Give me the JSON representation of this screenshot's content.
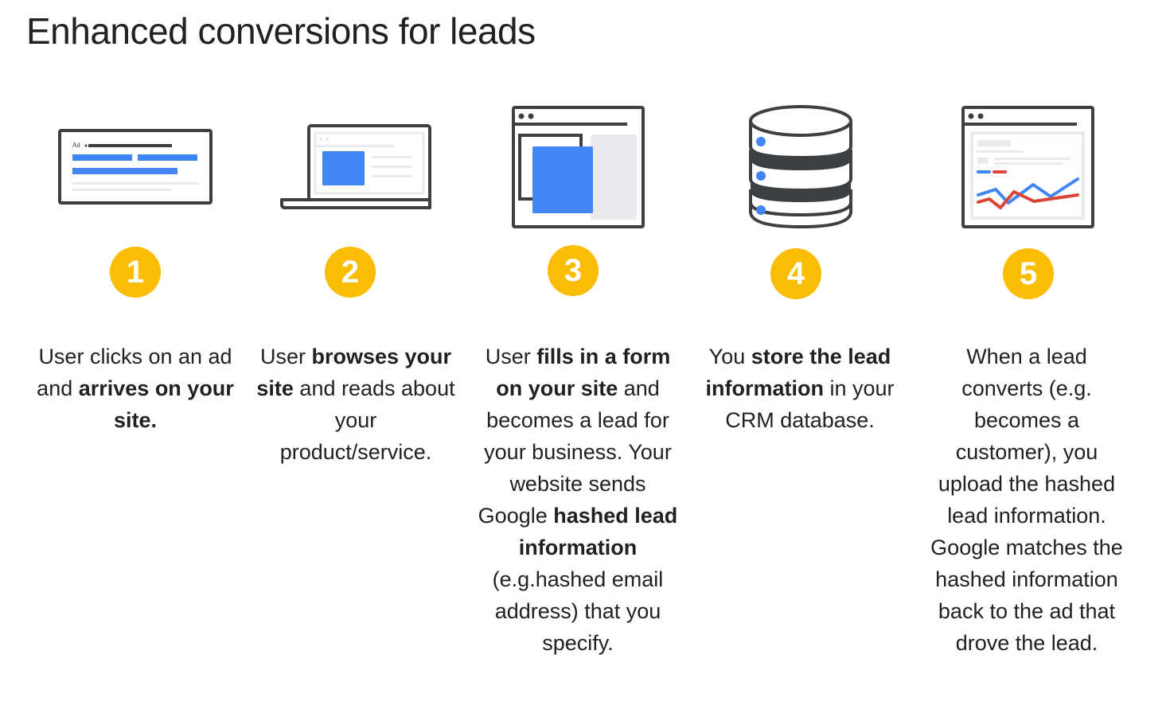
{
  "title": "Enhanced conversions for leads",
  "colors": {
    "badge": "#FBBC04",
    "badge_text": "#FFFFFF",
    "outline": "#3C4043",
    "accent_blue": "#4285F4",
    "accent_red": "#DB4437",
    "placeholder_gray": "#E8EAED"
  },
  "steps": [
    {
      "number": "1",
      "icon": "search-ad-icon",
      "icon_label": "Ad",
      "parts": [
        {
          "text": "User clicks on an ad and ",
          "bold": false
        },
        {
          "text": "arrives on your site.",
          "bold": true
        }
      ]
    },
    {
      "number": "2",
      "icon": "laptop-icon",
      "parts": [
        {
          "text": "User ",
          "bold": false
        },
        {
          "text": "browses your site",
          "bold": true
        },
        {
          "text": " and reads about your product/service.",
          "bold": false
        }
      ]
    },
    {
      "number": "3",
      "icon": "web-form-icon",
      "parts": [
        {
          "text": "User ",
          "bold": false
        },
        {
          "text": "fills in a form on your site",
          "bold": true
        },
        {
          "text": " and becomes a lead for your business. Your website sends Google ",
          "bold": false
        },
        {
          "text": "hashed lead information",
          "bold": true
        },
        {
          "text": " (e.g.hashed email address) that you specify.",
          "bold": false
        }
      ]
    },
    {
      "number": "4",
      "icon": "database-icon",
      "parts": [
        {
          "text": "You ",
          "bold": false
        },
        {
          "text": "store the lead information",
          "bold": true
        },
        {
          "text": " in your CRM database.",
          "bold": false
        }
      ]
    },
    {
      "number": "5",
      "icon": "analytics-report-icon",
      "parts": [
        {
          "text": "When a lead converts (e.g. becomes a customer), you upload the hashed lead information. Google matches the hashed information back to the ad that drove the lead.",
          "bold": false
        }
      ]
    }
  ]
}
